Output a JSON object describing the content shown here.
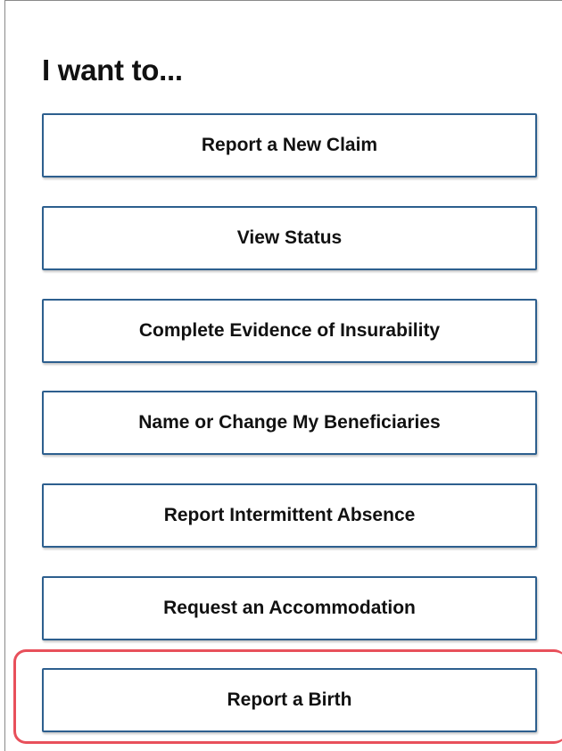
{
  "heading": "I want to...",
  "actions": [
    {
      "label": "Report a New Claim"
    },
    {
      "label": "View Status"
    },
    {
      "label": "Complete Evidence of Insurability"
    },
    {
      "label": "Name or Change My Beneficiaries"
    },
    {
      "label": "Report Intermittent Absence"
    },
    {
      "label": "Request an Accommodation"
    },
    {
      "label": "Report a Birth"
    }
  ],
  "colors": {
    "button_border": "#2d5f8e",
    "highlight": "#e8505b",
    "text": "#111111"
  }
}
